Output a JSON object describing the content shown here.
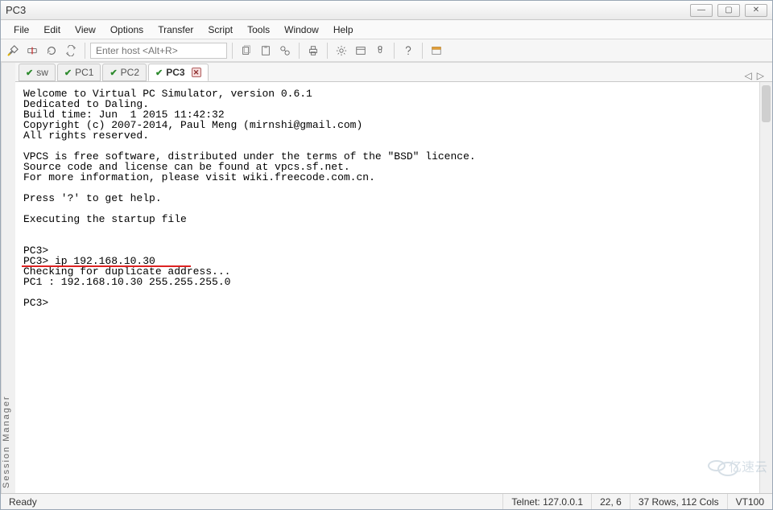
{
  "window": {
    "title": "PC3"
  },
  "menu": [
    "File",
    "Edit",
    "View",
    "Options",
    "Transfer",
    "Script",
    "Tools",
    "Window",
    "Help"
  ],
  "toolbar": {
    "host_placeholder": "Enter host <Alt+R>"
  },
  "side_panel_label": "Session Manager",
  "tabs": [
    {
      "label": "sw",
      "active": false
    },
    {
      "label": "PC1",
      "active": false
    },
    {
      "label": "PC2",
      "active": false
    },
    {
      "label": "PC3",
      "active": true
    }
  ],
  "terminal_lines": [
    "Welcome to Virtual PC Simulator, version 0.6.1",
    "Dedicated to Daling.",
    "Build time: Jun  1 2015 11:42:32",
    "Copyright (c) 2007-2014, Paul Meng (mirnshi@gmail.com)",
    "All rights reserved.",
    "",
    "VPCS is free software, distributed under the terms of the \"BSD\" licence.",
    "Source code and license can be found at vpcs.sf.net.",
    "For more information, please visit wiki.freecode.com.cn.",
    "",
    "Press '?' to get help.",
    "",
    "Executing the startup file",
    "",
    "",
    "PC3>",
    "PC3> ip 192.168.10.30",
    "Checking for duplicate address...",
    "PC1 : 192.168.10.30 255.255.255.0",
    "",
    "PC3>"
  ],
  "highlight_command_line_index": 16,
  "status": {
    "ready": "Ready",
    "telnet": "Telnet: 127.0.0.1",
    "cursor": "22,  6",
    "size": "37 Rows, 112 Cols",
    "term": "VT100"
  },
  "watermark_text": "亿速云"
}
